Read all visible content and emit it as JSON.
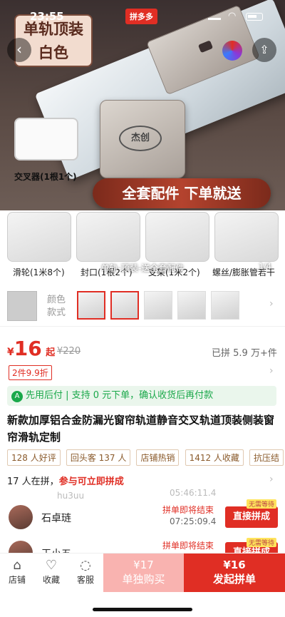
{
  "status": {
    "time": "23:55",
    "brand": "拼多多"
  },
  "hero": {
    "tag_line1": "单轨顶装",
    "tag_line2": "白色",
    "inset_label": "交叉器(1根1个)",
    "banner": "全套配件 下单就送",
    "logo": "杰创",
    "caption": "单轨-顶装-送全套配件",
    "pager": "1/4",
    "thumbs": [
      "滑轮(1米8个)",
      "封口(1根2个)",
      "支架(1米2个)",
      "螺丝/膨胀管若干"
    ]
  },
  "sku": {
    "label_line1": "颜色",
    "label_line2": "款式"
  },
  "price": {
    "symbol": "¥",
    "value": "16",
    "suffix": "起",
    "original": "¥220",
    "sold": "已拼 5.9 万+件",
    "coupon": "2件9.9折"
  },
  "paylater": {
    "badge": "A",
    "text": "先用后付 | 支持 0 元下单，确认收货后再付款"
  },
  "title": "新款加厚铝合金防漏光窗帘轨道静音交叉轨道顶装侧装窗帘滑轨定制",
  "tags": [
    "128 人好评",
    "回头客 137 人",
    "店铺热销",
    "1412 人收藏",
    "抗压结"
  ],
  "pinning": {
    "text": "17 人在拼，",
    "highlight": "参与可立即拼成"
  },
  "ghost": {
    "name": "hu3uu",
    "time": "05:46:11.4"
  },
  "groups": [
    {
      "name": "石卓琏",
      "status": "拼单即将结束",
      "time": "07:25:09.4",
      "join": "直接拼成",
      "badge": "无需等待"
    },
    {
      "name": "王小五",
      "status": "拼单即将结束",
      "time": "",
      "join": "直接拼成",
      "badge": "无需等待"
    }
  ],
  "bottom": {
    "shop": "店铺",
    "fav": "收藏",
    "service": "客服",
    "solo_price": "¥17",
    "solo_label": "单独购买",
    "group_price": "¥16",
    "group_label": "发起拼单"
  },
  "icons": {
    "shop": "shop-icon",
    "fav": "heart-icon",
    "service": "chat-icon"
  },
  "colors": {
    "accent": "#e02e24",
    "green": "#1aa84a"
  }
}
